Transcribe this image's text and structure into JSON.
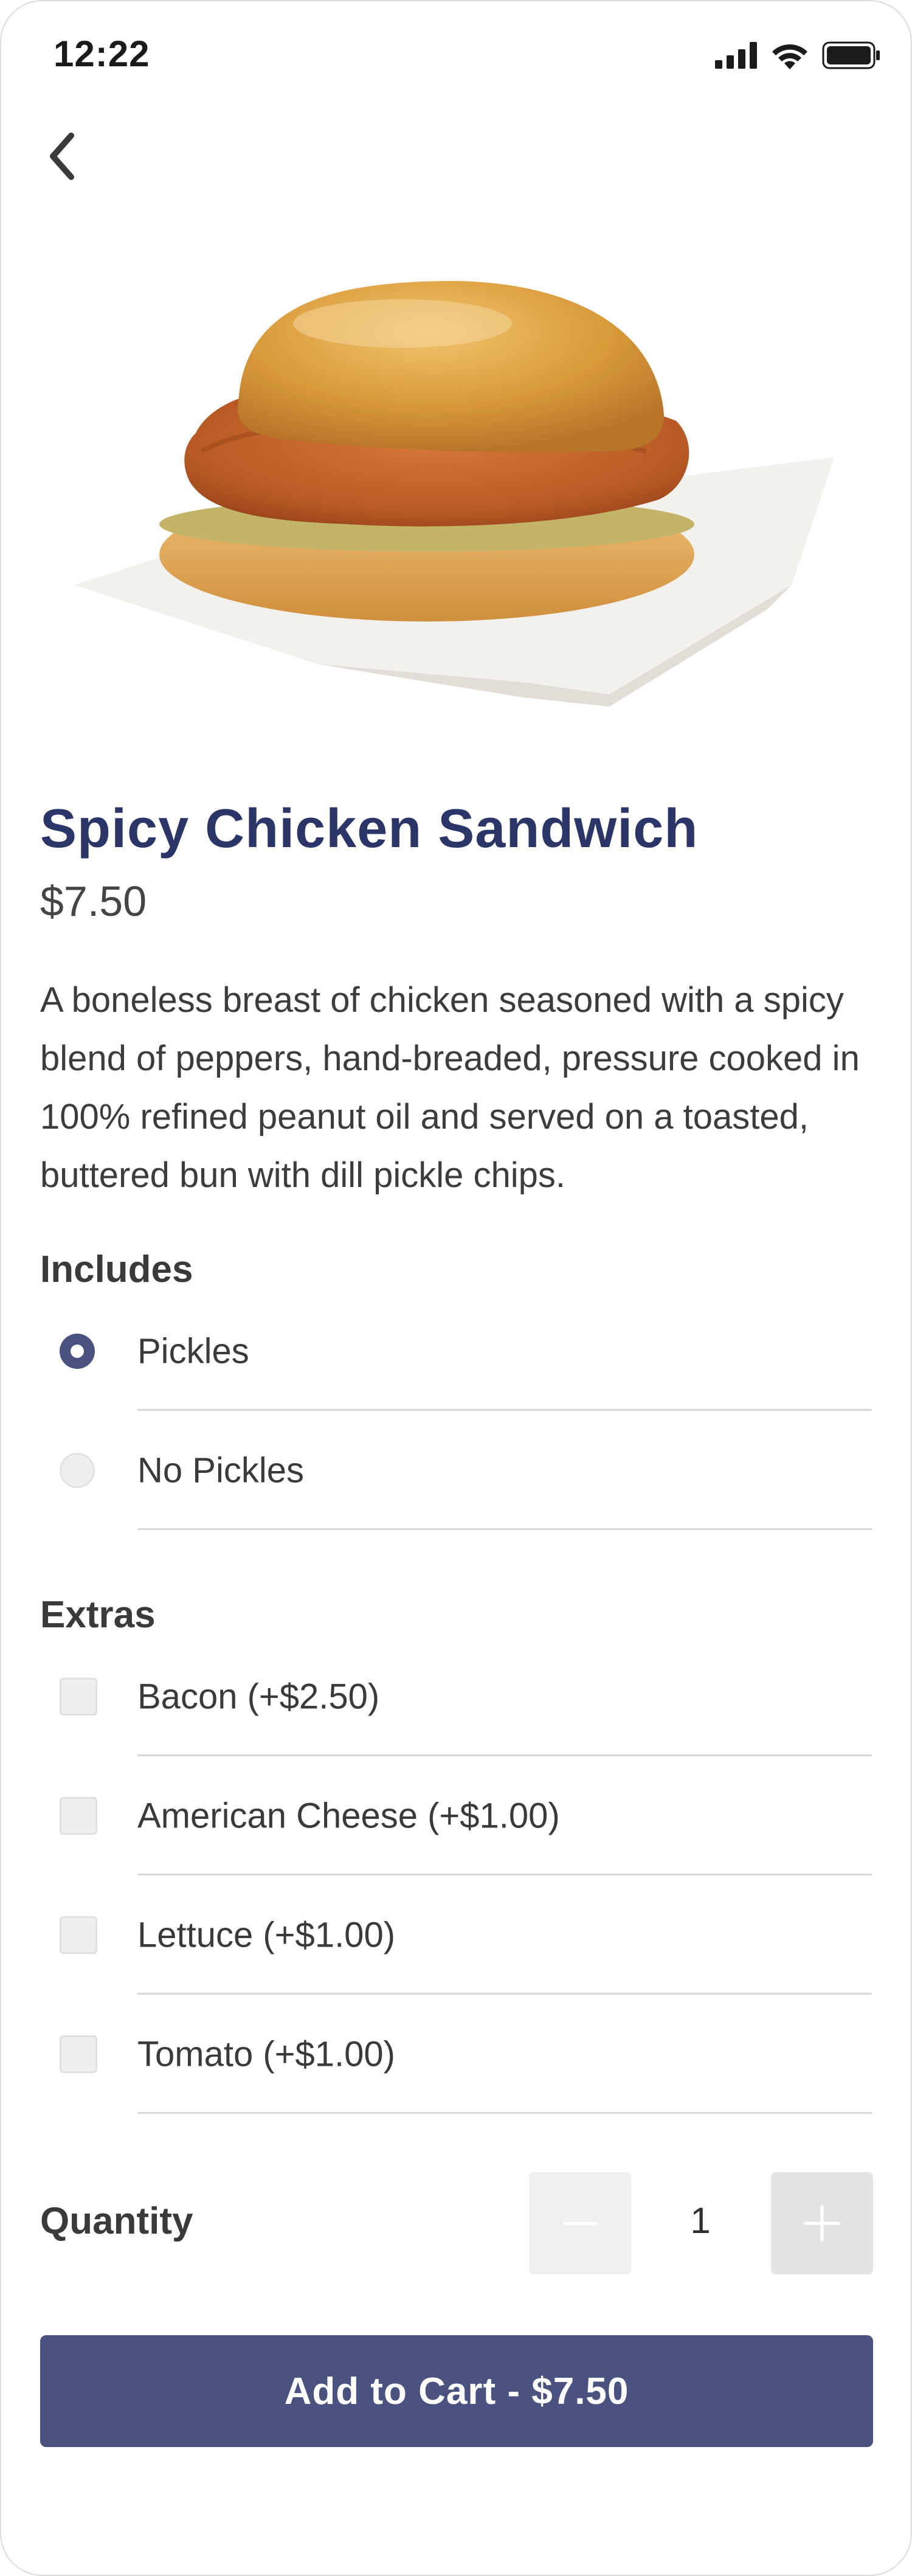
{
  "status_bar": {
    "time": "12:22",
    "icons": [
      "signal-icon",
      "wifi-icon",
      "battery-icon"
    ]
  },
  "nav": {
    "back_icon": "chevron-left-icon"
  },
  "product": {
    "image": "chicken-sandwich-image",
    "title": "Spicy Chicken Sandwich",
    "price": "$7.50",
    "description": "A boneless breast of chicken seasoned with a spicy blend of peppers, hand-breaded, pressure cooked in 100% refined peanut oil and served on a toasted, buttered bun with dill pickle chips."
  },
  "includes": {
    "heading": "Includes",
    "options": [
      {
        "label": "Pickles",
        "selected": true
      },
      {
        "label": "No Pickles",
        "selected": false
      }
    ]
  },
  "extras": {
    "heading": "Extras",
    "options": [
      {
        "label": "Bacon (+$2.50)",
        "checked": false
      },
      {
        "label": "American Cheese (+$1.00)",
        "checked": false
      },
      {
        "label": "Lettuce (+$1.00)",
        "checked": false
      },
      {
        "label": "Tomato (+$1.00)",
        "checked": false
      }
    ]
  },
  "quantity": {
    "label": "Quantity",
    "value": "1",
    "minus_icon": "minus-icon",
    "plus_icon": "plus-icon"
  },
  "cart": {
    "button_label": "Add to Cart - $7.50"
  },
  "colors": {
    "accent": "#4a527f",
    "title": "#2b3568"
  }
}
